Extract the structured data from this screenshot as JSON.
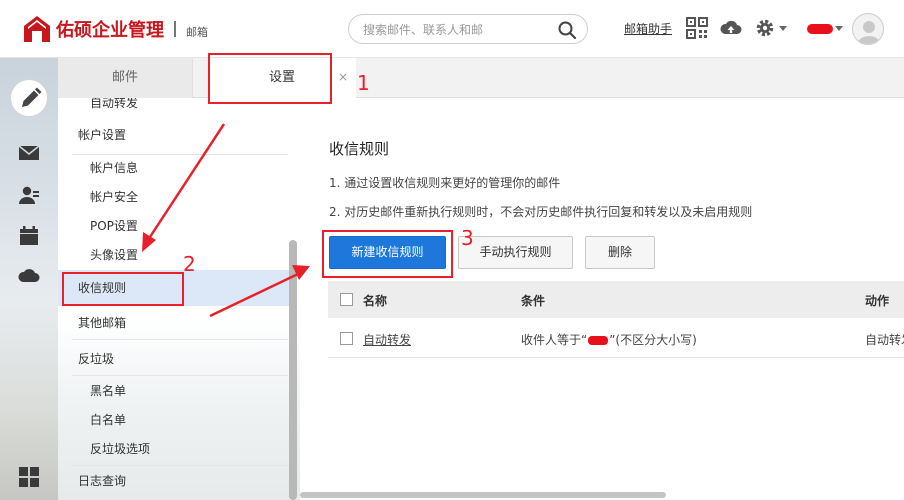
{
  "header": {
    "brand": "佑硕企业管理",
    "product": "邮箱",
    "search_placeholder": "搜索邮件、联系人和邮",
    "help_link": "邮箱助手",
    "icons": [
      "qrcode-icon",
      "cloud-icon",
      "gear-icon"
    ]
  },
  "tabs": [
    {
      "label": "邮件"
    },
    {
      "label": "设置",
      "close": "×"
    }
  ],
  "sidebar": {
    "items": [
      {
        "label": "自动转发",
        "kind": "sub"
      },
      {
        "label": "帐户设置",
        "kind": "head"
      },
      {
        "label": "帐户信息",
        "kind": "sub"
      },
      {
        "label": "帐户安全",
        "kind": "sub"
      },
      {
        "label": "POP设置",
        "kind": "sub"
      },
      {
        "label": "头像设置",
        "kind": "sub"
      },
      {
        "label": "收信规则",
        "kind": "head",
        "active": true
      },
      {
        "label": "其他邮箱",
        "kind": "head"
      },
      {
        "label": "反垃圾",
        "kind": "head"
      },
      {
        "label": "黑名单",
        "kind": "sub"
      },
      {
        "label": "白名单",
        "kind": "sub"
      },
      {
        "label": "反垃圾选项",
        "kind": "sub"
      },
      {
        "label": "日志查询",
        "kind": "head"
      }
    ]
  },
  "main": {
    "title": "收信规则",
    "desc1": "1. 通过设置收信规则来更好的管理你的邮件",
    "desc2": "2. 对历史邮件重新执行规则时，不会对历史邮件执行回复和转发以及未启用规则",
    "buttons": {
      "new_rule": "新建收信规则",
      "run_rule": "手动执行规则",
      "delete": "删除"
    },
    "table": {
      "columns": [
        "名称",
        "条件",
        "动作"
      ],
      "rows": [
        {
          "name": "自动转发",
          "condition_prefix": "收件人等于“",
          "condition_suffix": "”(不区分大小写)",
          "action": "自动转发"
        }
      ]
    }
  },
  "annotations": [
    "1",
    "2",
    "3"
  ],
  "colors": {
    "brand_red": "#c8161d",
    "primary_blue": "#1e78db",
    "annotation_red": "#e8202a",
    "active_item_bg": "#dce8f7"
  }
}
